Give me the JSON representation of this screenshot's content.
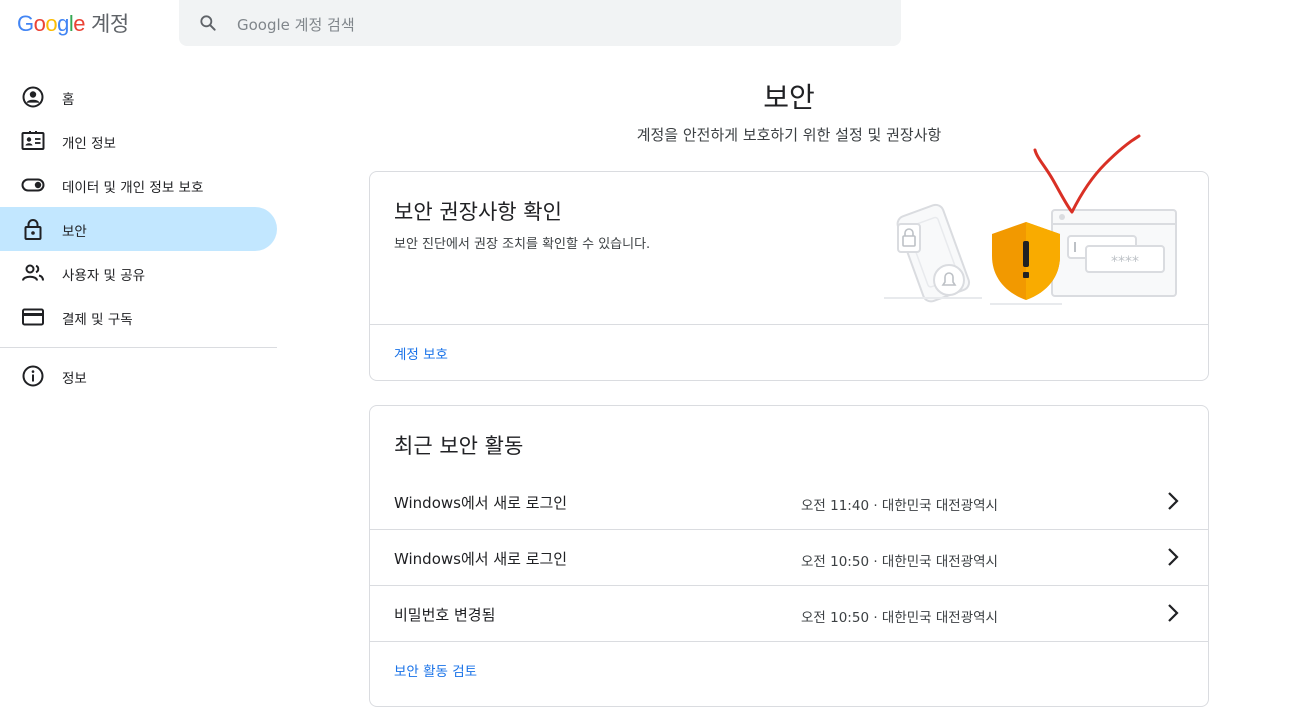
{
  "header": {
    "logo_letters": [
      "G",
      "o",
      "o",
      "g",
      "l",
      "e"
    ],
    "product": "계정",
    "search_placeholder": "Google 계정 검색",
    "search_icon": "search-icon"
  },
  "nav": {
    "items": [
      {
        "label": "홈",
        "icon": "account-circle-icon",
        "active": false
      },
      {
        "label": "개인 정보",
        "icon": "id-card-icon",
        "active": false
      },
      {
        "label": "데이터 및 개인 정보 보호",
        "icon": "toggle-icon",
        "active": false
      },
      {
        "label": "보안",
        "icon": "lock-icon",
        "active": true
      },
      {
        "label": "사용자 및 공유",
        "icon": "people-icon",
        "active": false
      },
      {
        "label": "결제 및 구독",
        "icon": "credit-card-icon",
        "active": false
      }
    ],
    "info_item": {
      "label": "정보",
      "icon": "info-icon"
    }
  },
  "page": {
    "title": "보안",
    "subtitle": "계정을 안전하게 보호하기 위한 설정 및 권장사항"
  },
  "recommendations_card": {
    "title": "보안 권장사항 확인",
    "description": "보안 진단에서 권장 조치를 확인할 수 있습니다.",
    "link": "계정 보호",
    "illustration": "security-shield-warning-icon",
    "password_mask": "****"
  },
  "activity_card": {
    "title": "최근 보안 활동",
    "rows": [
      {
        "event": "Windows에서 새로 로그인",
        "meta": "오전 11:40 · 대한민국 대전광역시"
      },
      {
        "event": "Windows에서 새로 로그인",
        "meta": "오전 10:50 · 대한민국 대전광역시"
      },
      {
        "event": "비밀번호 변경됨",
        "meta": "오전 10:50 · 대한민국 대전광역시"
      }
    ],
    "link": "보안 활동 검토"
  },
  "colors": {
    "accent": "#1a73e8",
    "active_nav": "#c2e7ff",
    "shield": "#f9ab00",
    "annotation": "#d93025"
  }
}
